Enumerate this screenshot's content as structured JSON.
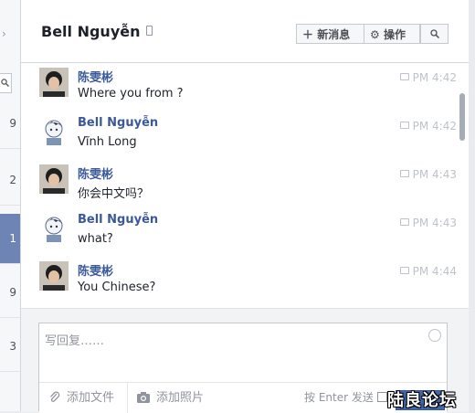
{
  "conversation": {
    "title": "Bell Nguyễn",
    "buttons": {
      "new_message": "新消息",
      "actions": "操作"
    }
  },
  "thread_list": {
    "counts": [
      "9",
      "2",
      "1",
      "9",
      "3"
    ],
    "active_index": 2
  },
  "messages": [
    {
      "sender": "陈雯彬",
      "text": "Where you from ?",
      "time": "PM 4:42",
      "avatar": "photo"
    },
    {
      "sender": "Bell Nguyễn",
      "text": "Vĩnh Long",
      "time": "PM 4:42",
      "avatar": "cartoon"
    },
    {
      "sender": "陈雯彬",
      "text": "你会中文吗？",
      "time": "PM 4:43",
      "avatar": "photo"
    },
    {
      "sender": "Bell Nguyễn",
      "text": "what?",
      "time": "PM 4:43",
      "avatar": "cartoon"
    },
    {
      "sender": "陈雯彬",
      "text": "You Chinese?",
      "time": "PM 4:44",
      "avatar": "photo"
    }
  ],
  "composer": {
    "placeholder": "写回复……",
    "add_file": "添加文件",
    "add_photo": "添加照片",
    "enter_to_send": "按 Enter 发送"
  },
  "watermark": "陆良论坛",
  "colors": {
    "accent": "#3b5998",
    "active_row": "#6d84b4",
    "send": "#4267b2"
  }
}
